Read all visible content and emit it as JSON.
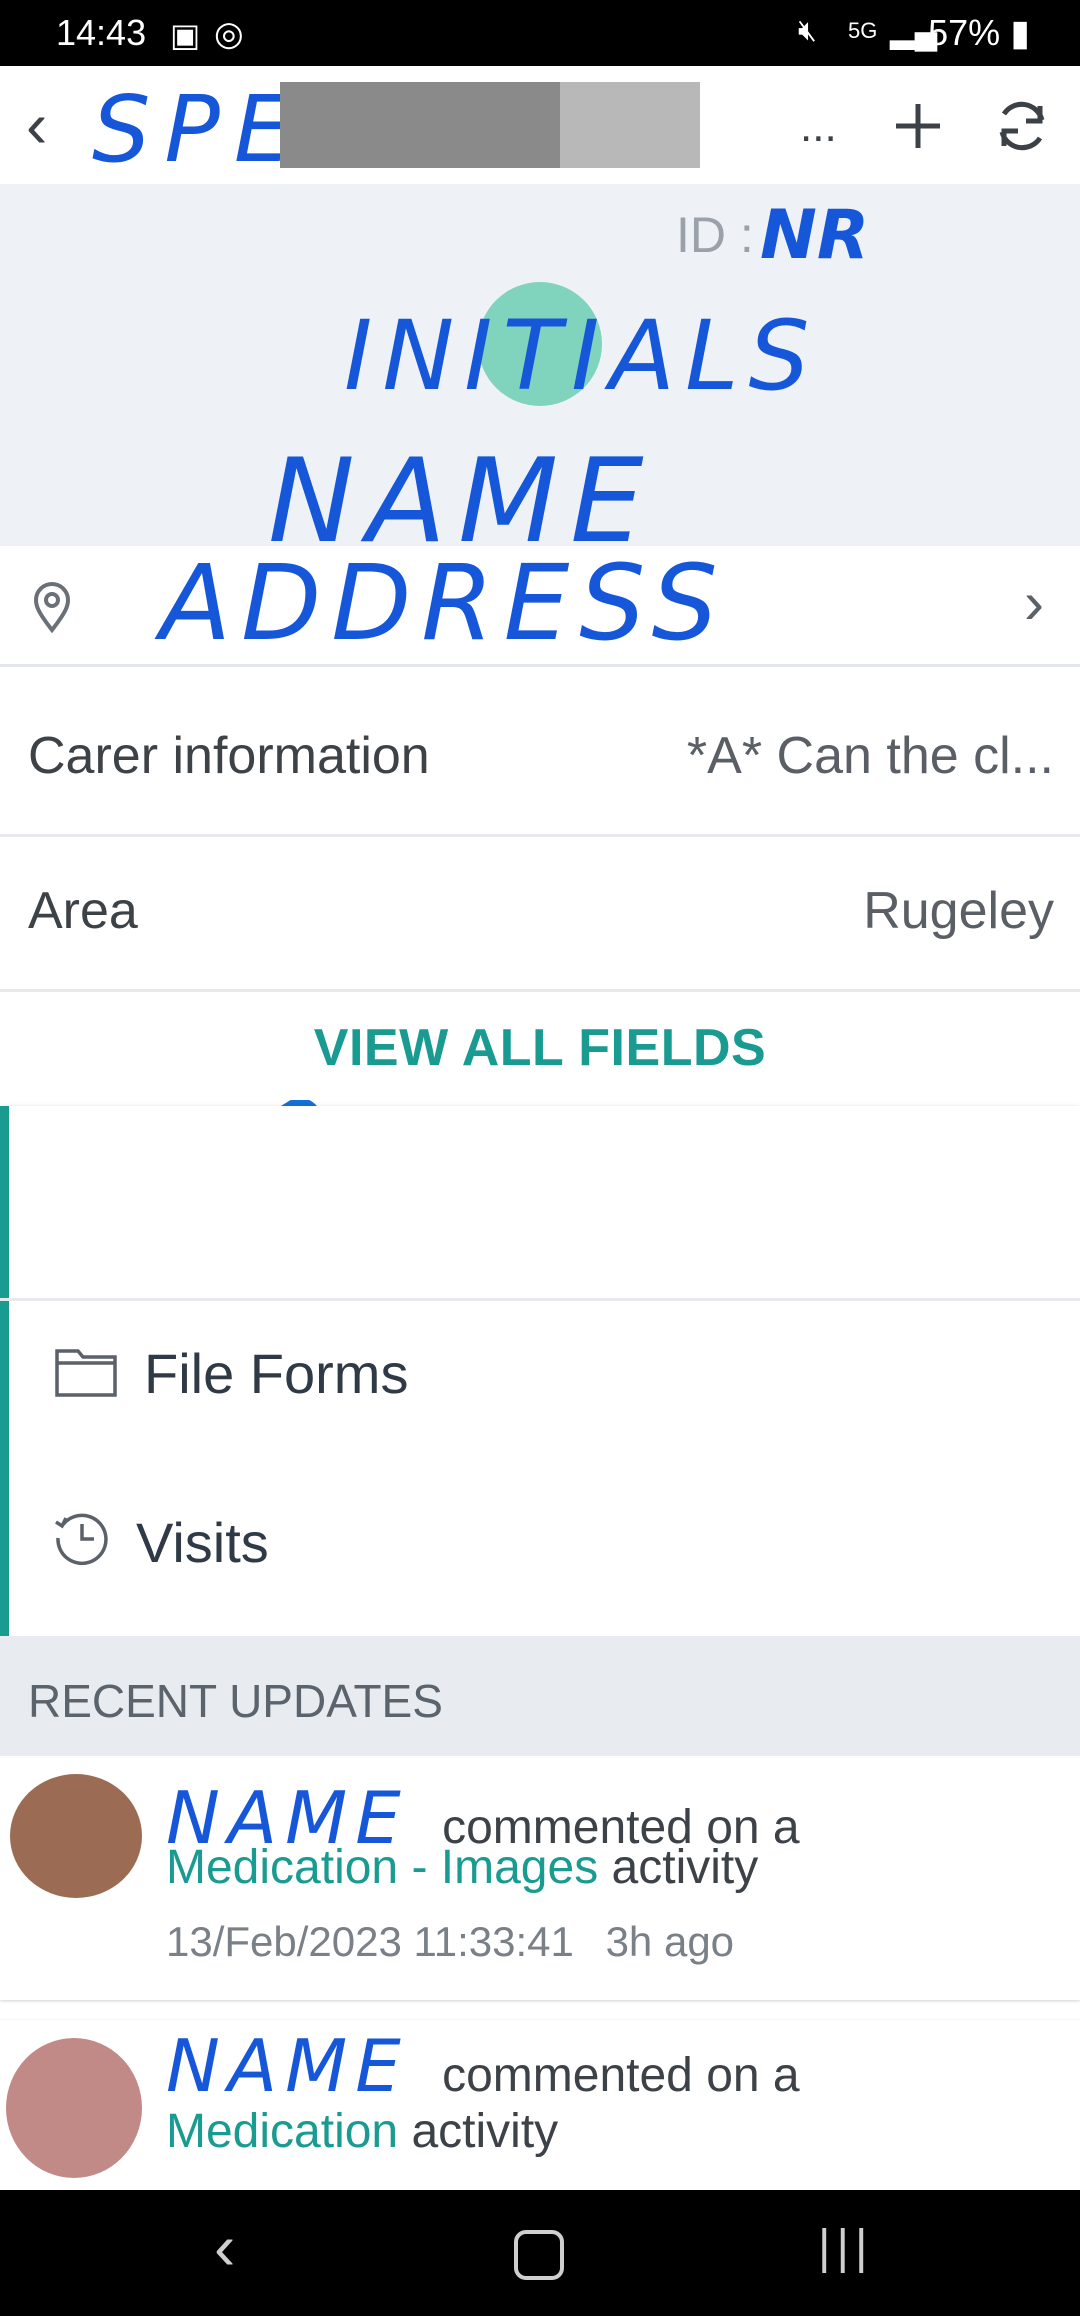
{
  "status_bar": {
    "time": "14:43",
    "battery": "57%"
  },
  "header": {
    "handwritten_title": "SPEC",
    "more_label": "...",
    "add_icon": "plus-icon",
    "refresh_icon": "refresh-icon"
  },
  "profile": {
    "id_label": "ID :",
    "id_value_handwritten": "NR",
    "initials_handwritten": "INITIALS",
    "name_handwritten": "NAME",
    "address_handwritten": "ADDRESS"
  },
  "fields": [
    {
      "label": "Carer information",
      "value": "*A*  Can the cl..."
    },
    {
      "label": "Area",
      "value": "Rugeley"
    }
  ],
  "view_all_label": "VIEW ALL FIELDS",
  "menu": [
    {
      "label": "File Forms",
      "icon": "folder-icon"
    },
    {
      "label": "Visits",
      "icon": "clock-history-icon"
    }
  ],
  "recent_updates": {
    "heading": "RECENT UPDATES",
    "items": [
      {
        "name_handwritten": "NAME",
        "action": "commented on a",
        "link": "Medication - Images",
        "suffix": "activity",
        "timestamp": "13/Feb/2023 11:33:41",
        "relative": "3h ago",
        "avatar_color": "#9b6b54"
      },
      {
        "name_handwritten": "NAME",
        "action": "commented on a",
        "link": "Medication",
        "suffix": "activity",
        "avatar_color": "#c18a86"
      }
    ]
  },
  "colors": {
    "accent": "#1a9b92",
    "handwriting": "#1557d8"
  }
}
